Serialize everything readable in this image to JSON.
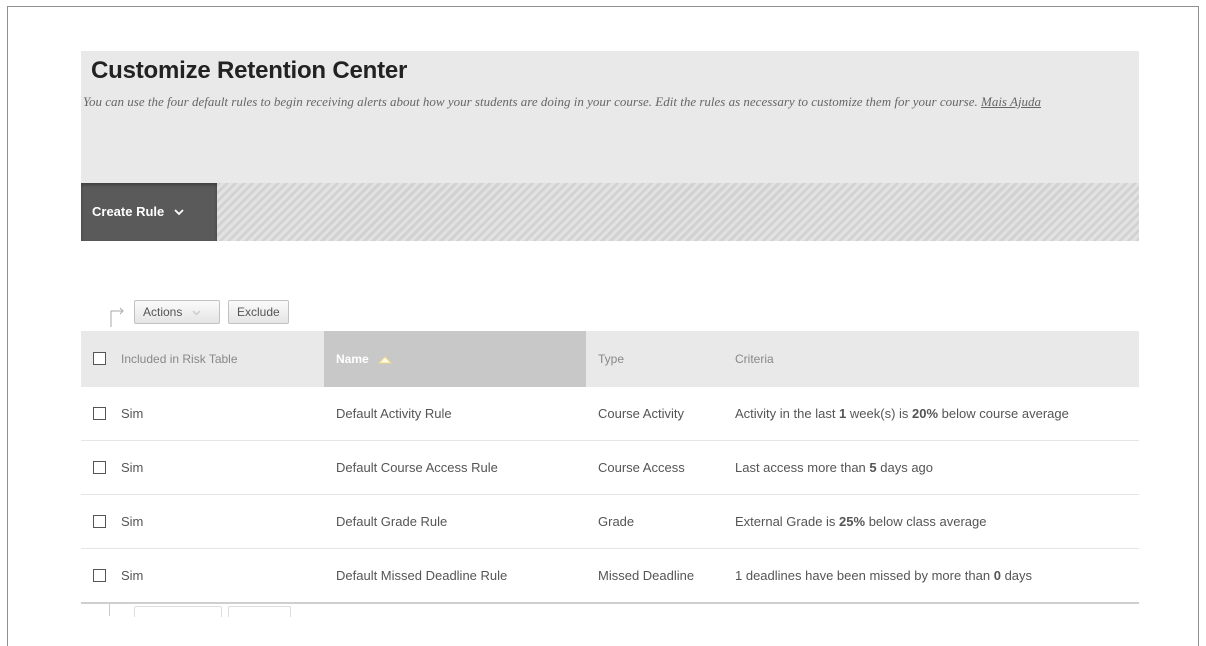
{
  "header": {
    "title": "Customize Retention Center",
    "description": "You can use the four default rules to begin receiving alerts about how your students are doing in your course. Edit the rules as necessary to customize them for your course.",
    "help_link": "Mais Ajuda"
  },
  "toolbar": {
    "create_rule_label": "Create Rule",
    "create_rule_icon": "chevron-down-icon"
  },
  "actions_bar": {
    "actions_label": "Actions",
    "exclude_label": "Exclude"
  },
  "table": {
    "columns": {
      "included": "Included in Risk Table",
      "name": "Name",
      "type": "Type",
      "criteria": "Criteria"
    },
    "rows": [
      {
        "included": "Sim",
        "name": "Default Activity Rule",
        "type": "Course Activity",
        "criteria_pre": "Activity in the last ",
        "criteria_b1": "1",
        "criteria_mid": " week(s) is ",
        "criteria_b2": "20%",
        "criteria_post": " below course average"
      },
      {
        "included": "Sim",
        "name": "Default Course Access Rule",
        "type": "Course Access",
        "criteria_pre": "Last access more than ",
        "criteria_b1": "5",
        "criteria_mid": " days ago",
        "criteria_b2": "",
        "criteria_post": ""
      },
      {
        "included": "Sim",
        "name": "Default Grade Rule",
        "type": "Grade",
        "criteria_pre": "External Grade is ",
        "criteria_b1": "25%",
        "criteria_mid": " below class average",
        "criteria_b2": "",
        "criteria_post": ""
      },
      {
        "included": "Sim",
        "name": "Default Missed Deadline Rule",
        "type": "Missed Deadline",
        "criteria_pre": "1 deadlines have been missed by more than ",
        "criteria_b1": "0",
        "criteria_mid": " days",
        "criteria_b2": "",
        "criteria_post": ""
      }
    ]
  },
  "colors": {
    "header_bg": "#e9e9e9",
    "toolbar_button_bg": "#5a5a5a",
    "sorted_column_bg": "#c8c8c8"
  }
}
